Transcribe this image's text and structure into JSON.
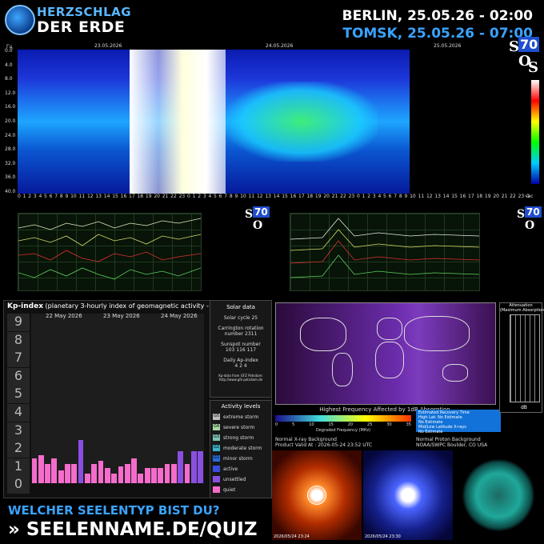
{
  "header": {
    "brand_line1": "HERZSCHLAG",
    "brand_line2": "DER ERDE",
    "time_berlin": "BERLIN, 25.05.26 - 02:00",
    "time_tomsk": "TOMSK, 25.05.26 - 07:00"
  },
  "spectrogram": {
    "unit": "Гц",
    "dates": [
      "23.05.2026",
      "24.05.2026",
      "25.05.2026"
    ],
    "y_ticks": [
      "0.0",
      "4.0",
      "8.0",
      "12.0",
      "16.0",
      "20.0",
      "24.0",
      "28.0",
      "32.0",
      "36.0",
      "40.0"
    ],
    "hours_unit": "час"
  },
  "sos": {
    "s1": "S",
    "n": "70",
    "o": "O",
    "s2": "S"
  },
  "kp": {
    "title_bold": "Kp-index",
    "title_rest": "(planetary 3-hourly index of geomagnetic activity - provisional data)",
    "levels": [
      "9",
      "8",
      "7",
      "6",
      "5",
      "4",
      "3",
      "2",
      "1",
      "0"
    ],
    "days": [
      "22 May 2026",
      "23 May 2026",
      "24 May 2026"
    ],
    "values": [
      1.3,
      1.5,
      1.0,
      1.3,
      0.7,
      1.0,
      1.0,
      2.3,
      0.5,
      1.0,
      1.2,
      0.8,
      0.5,
      0.9,
      1.0,
      1.3,
      0.5,
      0.8,
      0.8,
      0.8,
      1.0,
      1.0,
      1.7,
      1.0,
      1.7,
      1.7
    ],
    "colors": {
      "quiet": "#f56ccc",
      "unsettled": "#8a4fe0"
    }
  },
  "solar": {
    "title": "Solar data",
    "cycle": "Solar cycle 25",
    "carrington": "Carrington rotation number 2311",
    "sunspot_label": "Sunspot number",
    "sunspot_values": "103   116   117",
    "ap_label": "Daily Ap-index",
    "ap_values": "4     2     4",
    "source": "Kp-data from GFZ Potsdam: http://www.gfz-potsdam.de"
  },
  "activity": {
    "title": "Activity levels",
    "items": [
      {
        "code": "G5",
        "label": "extreme storm",
        "color": "#bdbdbd"
      },
      {
        "code": "G4",
        "label": "severe storm",
        "color": "#a7d6a2"
      },
      {
        "code": "G3",
        "label": "strong storm",
        "color": "#7fc4b4"
      },
      {
        "code": "G2",
        "label": "moderate storm",
        "color": "#3db2c9"
      },
      {
        "code": "G1",
        "label": "minor storm",
        "color": "#2a6ad9"
      },
      {
        "code": "",
        "label": "active",
        "color": "#3b4de0"
      },
      {
        "code": "",
        "label": "unsettled",
        "color": "#8a4fe0"
      },
      {
        "code": "",
        "label": "quiet",
        "color": "#f56ccc"
      }
    ]
  },
  "absorption": {
    "title": "Highest Frequency Affected by 1dB Absorption",
    "axis": "Degraded Frequency (MHz)",
    "ticks": [
      "0",
      "5",
      "10",
      "15",
      "20",
      "25",
      "30",
      "35"
    ],
    "estimate": "Estimated Recovery Time\nHigh Lat: No Estimate\nNo Estimate\nMid/Low Latitude X-rays\nNo Estimate",
    "att_title": "Attenuation\n(Maximum Absorption)",
    "att_unit": "dB",
    "xray_line1": "Normal X-ray Background",
    "xray_line2": "Product Valid At : 2026-05-24 23:52 UTC",
    "proton_line1": "Normal Proton Background",
    "proton_line2": "NOAA/SWPC Boulder, CO USA"
  },
  "images": {
    "img1_time": "2026/05/24 23:24",
    "img2_time": "2026/05/24 23:30"
  },
  "footer": {
    "line1": "WELCHER SEELENTYP BIST DU?",
    "line2": "» SEELENNAME.DE/QUIZ"
  }
}
